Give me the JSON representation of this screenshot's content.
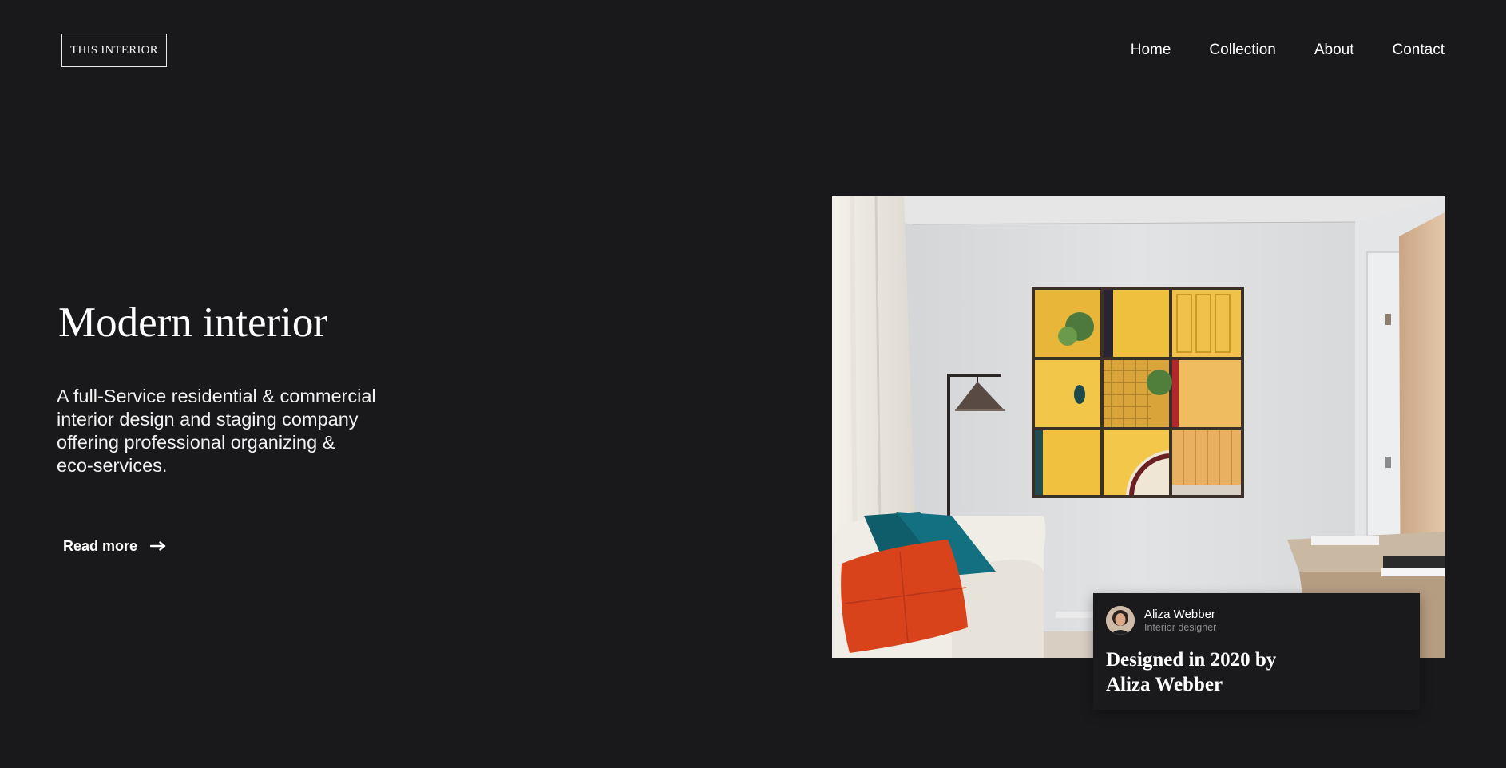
{
  "header": {
    "logo": "THIS INTERIOR",
    "nav": [
      {
        "label": "Home"
      },
      {
        "label": "Collection"
      },
      {
        "label": "About"
      },
      {
        "label": "Contact"
      }
    ]
  },
  "hero": {
    "title": "Modern interior",
    "description": "A full-Service residential & commercial interior design and staging company offering professional organizing & eco-services.",
    "cta": {
      "label": "Read more",
      "icon": "arrow-right-icon"
    }
  },
  "feature": {
    "image": "living-room-photo",
    "designer": {
      "name": "Aliza Webber",
      "role": "Interior designer",
      "avatar": "designer-avatar"
    },
    "caption": "Designed in 2020 by Aliza Webber"
  },
  "colors": {
    "background": "#19191b",
    "text": "#ffffff",
    "muted": "#8d8d8d"
  }
}
